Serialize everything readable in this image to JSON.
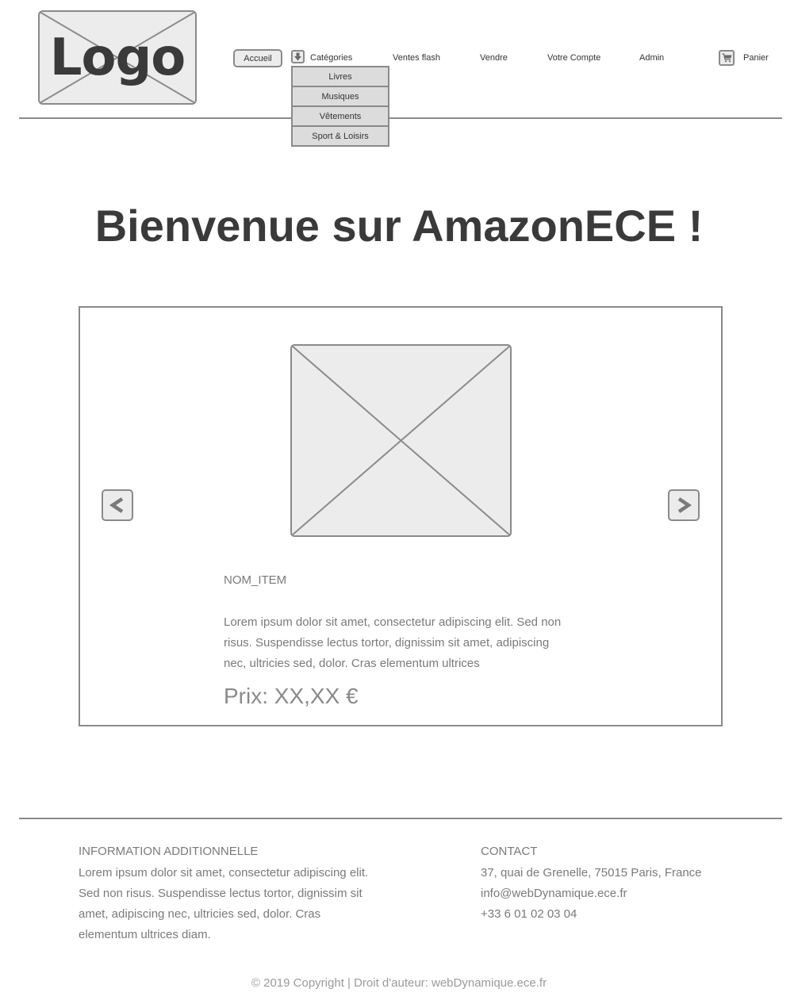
{
  "header": {
    "logo_text": "Logo",
    "nav": {
      "home": "Accueil",
      "categories": "Catégories",
      "flash_sales": "Ventes flash",
      "sell": "Vendre",
      "account": "Votre Compte",
      "admin": "Admin",
      "cart": "Panier"
    },
    "categories_menu": [
      "Livres",
      "Musiques",
      "Vêtements",
      "Sport & Loisirs"
    ]
  },
  "main": {
    "welcome": "Bienvenue sur AmazonECE !",
    "carousel": {
      "prev_label": "<",
      "next_label": ">",
      "item_name": "NOM_ITEM",
      "item_description": "Lorem ipsum dolor sit amet, consectetur adipiscing elit. Sed non risus. Suspendisse lectus tortor, dignissim sit amet, adipiscing nec, ultricies sed, dolor. Cras elementum ultrices",
      "item_price": "Prix: XX,XX €"
    }
  },
  "footer": {
    "info_title": "INFORMATION ADDITIONNELLE",
    "info_text": "Lorem ipsum dolor sit amet, consectetur adipiscing elit. Sed non risus. Suspendisse lectus tortor, dignissim sit amet, adipiscing nec, ultricies sed, dolor. Cras elementum ultrices diam.",
    "contact_title": "CONTACT",
    "contact_address": "37, quai de Grenelle, 75015 Paris, France",
    "contact_email": "info@webDynamique.ece.fr",
    "contact_phone": "+33 6 01 02 03 04",
    "copyright": "© 2019 Copyright | Droit d'auteur: webDynamique.ece.fr"
  },
  "icons": {
    "categories": "arrow-down-icon",
    "cart": "shopping-cart-icon",
    "prev": "chevron-left-icon",
    "next": "chevron-right-icon"
  },
  "colors": {
    "border": "#8a8a8a",
    "placeholder_fill": "#ececec",
    "heading_text": "#3a3a3a",
    "muted_text": "#7a7a7a"
  }
}
